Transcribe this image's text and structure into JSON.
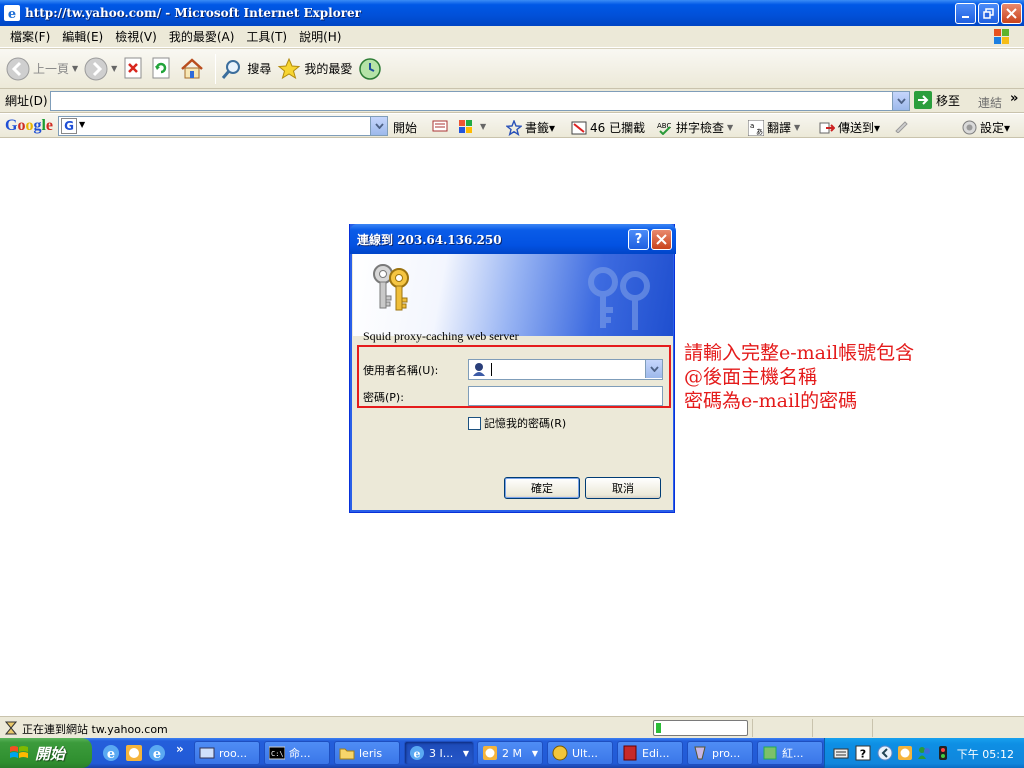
{
  "window": {
    "title": "http://tw.yahoo.com/ - Microsoft Internet Explorer"
  },
  "menu": [
    "檔案(F)",
    "編輯(E)",
    "檢視(V)",
    "我的最愛(A)",
    "工具(T)",
    "說明(H)"
  ],
  "toolbar": {
    "back": "上一頁",
    "search": "搜尋",
    "favorites": "我的最愛"
  },
  "address": {
    "label": "網址(D)",
    "value": "",
    "go": "移至",
    "links": "連結"
  },
  "google": {
    "start": "開始",
    "bookmarks": "書籤▾",
    "blocked": "46 已攔截",
    "spellcheck": "拼字檢查",
    "translate": "翻譯",
    "sendto": "傳送到▾",
    "settings": "設定▾"
  },
  "dialog": {
    "title": "連線到 203.64.136.250",
    "realm": "Squid proxy-caching web server",
    "username_label": "使用者名稱(U):",
    "password_label": "密碼(P):",
    "username_value": "",
    "password_value": "",
    "remember_label": "記憶我的密碼(R)",
    "remember_checked": false,
    "ok": "確定",
    "cancel": "取消"
  },
  "annotation": {
    "line1": "請輸入完整e-mail帳號包含",
    "line2": "@後面主機名稱",
    "line3": "密碼為e-mail的密碼"
  },
  "status": {
    "text": "正在連到網站 tw.yahoo.com",
    "progress": 0.06
  },
  "taskbar": {
    "start": "開始",
    "tasks": [
      "roo...",
      "命...",
      "leris",
      "3 I...",
      "2 M",
      "Ult...",
      "Edi...",
      "pro...",
      "紅..."
    ],
    "clock": "下午 05:12"
  },
  "colors": {
    "xp_blue": "#0058e6",
    "start_green": "#3c9b3c",
    "annotation_red": "#e41b1b"
  }
}
